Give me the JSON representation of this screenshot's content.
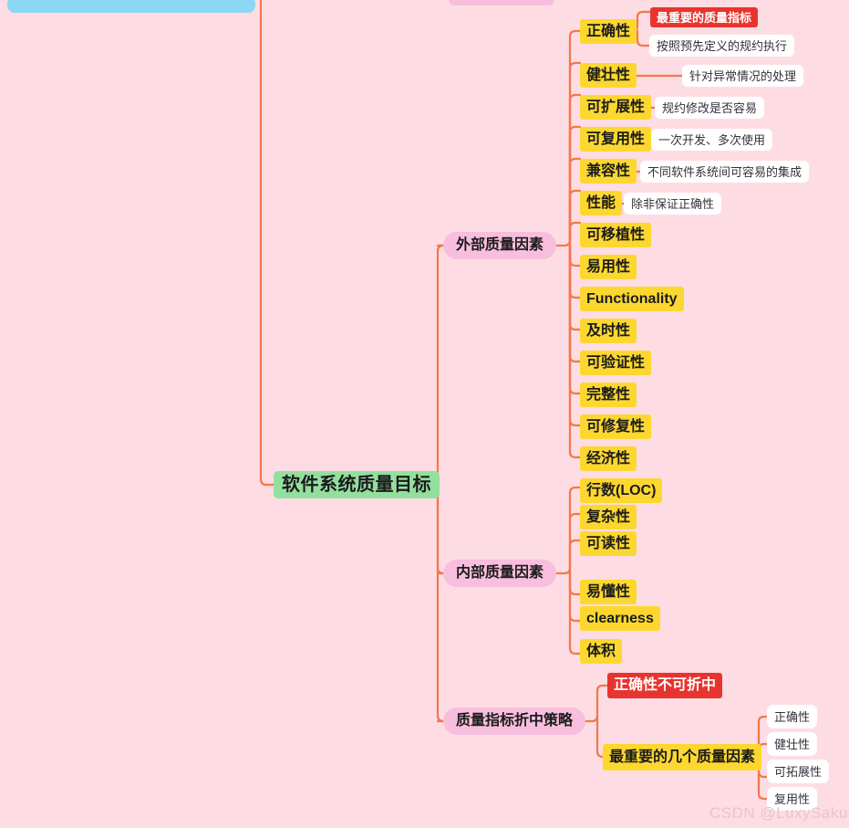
{
  "meta": {
    "background_color": "#fddde3",
    "connector_color": "#f2784b",
    "watermark": "CSDN @LuxySakura"
  },
  "root": {
    "label": "软件系统质量目标",
    "color": "#93df9e"
  },
  "branches": [
    {
      "id": "external",
      "label": "外部质量因素",
      "color": "#f8bedd",
      "children": [
        {
          "label": "正确性",
          "color": "#fcd730",
          "notes": [
            {
              "label": "最重要的质量指标",
              "color": "#e8342f",
              "text_color": "#ffffff"
            },
            {
              "label": "按照预先定义的规约执行",
              "color": "#ffffff",
              "text_color": "#32323c"
            }
          ]
        },
        {
          "label": "健壮性",
          "color": "#fcd730",
          "notes": [
            {
              "label": "针对异常情况的处理",
              "color": "#ffffff",
              "text_color": "#32323c"
            }
          ]
        },
        {
          "label": "可扩展性",
          "color": "#fcd730",
          "notes": [
            {
              "label": "规约修改是否容易",
              "color": "#ffffff",
              "text_color": "#32323c"
            }
          ]
        },
        {
          "label": "可复用性",
          "color": "#fcd730",
          "notes": [
            {
              "label": "一次开发、多次使用",
              "color": "#ffffff",
              "text_color": "#32323c"
            }
          ]
        },
        {
          "label": "兼容性",
          "color": "#fcd730",
          "notes": [
            {
              "label": "不同软件系统间可容易的集成",
              "color": "#ffffff",
              "text_color": "#32323c"
            }
          ]
        },
        {
          "label": "性能",
          "color": "#fcd730",
          "notes": [
            {
              "label": "除非保证正确性",
              "color": "#ffffff",
              "text_color": "#32323c"
            }
          ]
        },
        {
          "label": "可移植性",
          "color": "#fcd730",
          "notes": []
        },
        {
          "label": "易用性",
          "color": "#fcd730",
          "notes": []
        },
        {
          "label": "Functionality",
          "color": "#fcd730",
          "notes": []
        },
        {
          "label": "及时性",
          "color": "#fcd730",
          "notes": []
        },
        {
          "label": "可验证性",
          "color": "#fcd730",
          "notes": []
        },
        {
          "label": "完整性",
          "color": "#fcd730",
          "notes": []
        },
        {
          "label": "可修复性",
          "color": "#fcd730",
          "notes": []
        },
        {
          "label": "经济性",
          "color": "#fcd730",
          "notes": []
        }
      ]
    },
    {
      "id": "internal",
      "label": "内部质量因素",
      "color": "#f8bedd",
      "children": [
        {
          "label": "行数(LOC)",
          "color": "#fcd730",
          "notes": []
        },
        {
          "label": "复杂性",
          "color": "#fcd730",
          "notes": []
        },
        {
          "label": "可读性",
          "color": "#fcd730",
          "notes": []
        },
        {
          "label": "易懂性",
          "color": "#fcd730",
          "notes": []
        },
        {
          "label": "clearness",
          "color": "#fcd730",
          "notes": []
        },
        {
          "label": "体积",
          "color": "#fcd730",
          "notes": []
        }
      ]
    },
    {
      "id": "tradeoff",
      "label": "质量指标折中策略",
      "color": "#f8bedd",
      "children": [
        {
          "label": "正确性不可折中",
          "color": "#e8342f",
          "text_color": "#ffffff",
          "notes": []
        },
        {
          "label": "最重要的几个质量因素",
          "color": "#fcd730",
          "notes": [],
          "grandchildren": [
            {
              "label": "正确性",
              "color": "#ffffff"
            },
            {
              "label": "健壮性",
              "color": "#ffffff"
            },
            {
              "label": "可拓展性",
              "color": "#ffffff"
            },
            {
              "label": "复用性",
              "color": "#ffffff"
            }
          ]
        }
      ]
    }
  ],
  "offscreen": {
    "blue_panel_visible": true,
    "pink_node_visible": true
  }
}
